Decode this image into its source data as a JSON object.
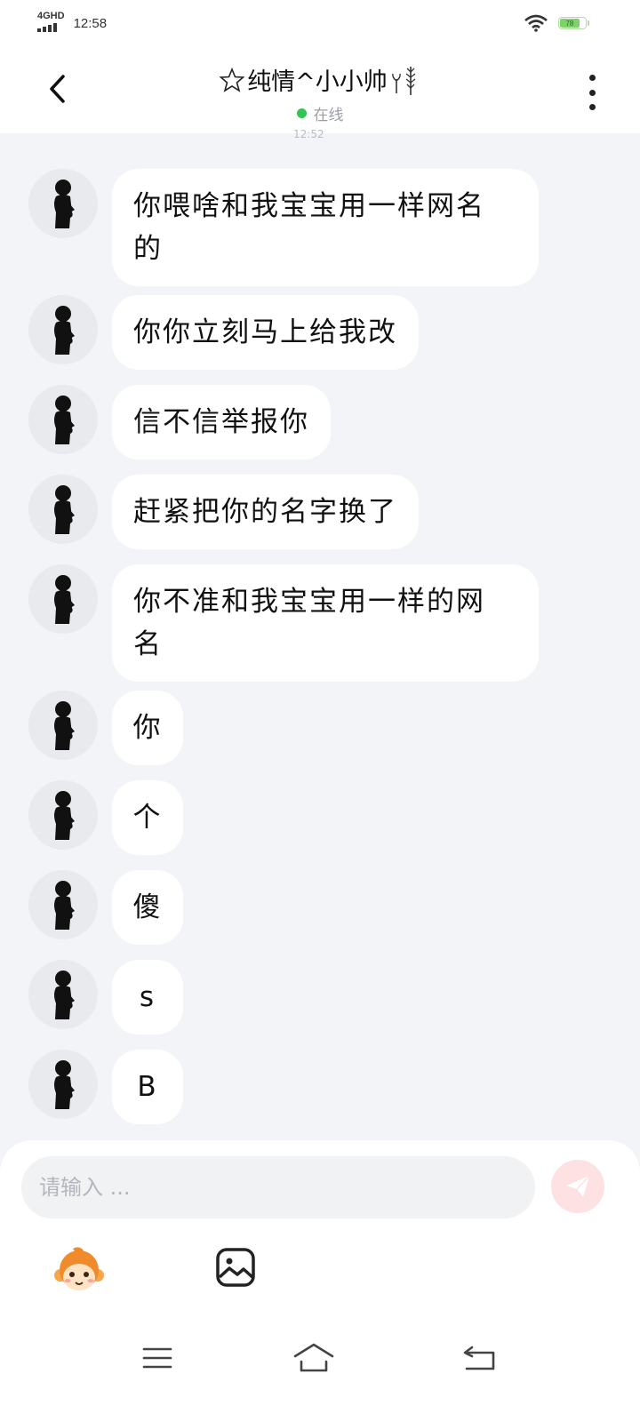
{
  "status_bar": {
    "network": "4GHD",
    "time": "12:58",
    "battery": "78",
    "battery_level": 0.78
  },
  "header": {
    "title": "纯情^小小帅",
    "status": "在线",
    "status_color": "#32c454"
  },
  "timestamp_peek": "12:52",
  "messages": [
    {
      "text": "你喂啥和我宝宝用一样网名的",
      "line1": "你喂啥和我宝宝用一样网名",
      "line2": "的"
    },
    {
      "text": "你你立刻马上给我改"
    },
    {
      "text": "信不信举报你"
    },
    {
      "text": "赶紧把你的名字换了"
    },
    {
      "text": "你不准和我宝宝用一样的网名",
      "line1": "你不准和我宝宝用一样的网",
      "line2": "名"
    },
    {
      "text": "你"
    },
    {
      "text": "个"
    },
    {
      "text": "傻"
    },
    {
      "text": "s"
    },
    {
      "text": "B"
    }
  ],
  "composer": {
    "placeholder": "请输入 ...",
    "value": "",
    "send_color": "#fde1e3"
  },
  "icons": {
    "back": "back-arrow-icon",
    "more": "more-vertical-icon",
    "send": "send-icon",
    "emoji": "monkey-emoji-icon",
    "image": "image-icon",
    "menu": "menu-icon",
    "home": "home-icon",
    "return": "return-icon"
  }
}
